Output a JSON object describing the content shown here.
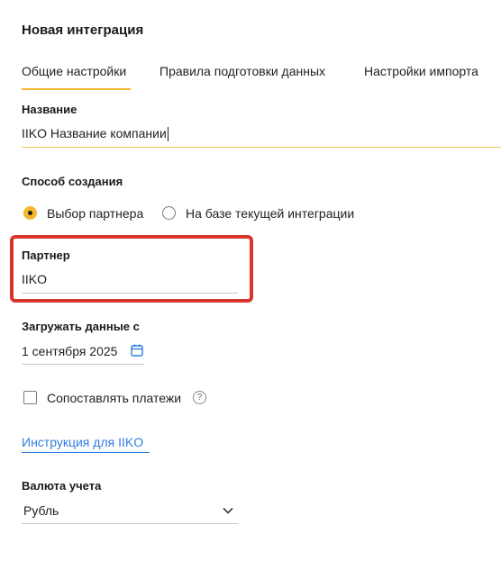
{
  "header": {
    "title": "Новая интеграция"
  },
  "tabs": [
    {
      "label": "Общие настройки",
      "active": true
    },
    {
      "label": "Правила подготовки данных",
      "active": false
    },
    {
      "label": "Настройки импорта",
      "active": false
    }
  ],
  "name_field": {
    "label": "Название",
    "value": "IIKO Название компании"
  },
  "creation_method": {
    "label": "Способ создания",
    "options": [
      {
        "label": "Выбор партнера",
        "selected": true
      },
      {
        "label": "На базе текущей интеграции",
        "selected": false
      }
    ]
  },
  "partner_field": {
    "label": "Партнер",
    "value": "IIKO"
  },
  "load_from": {
    "label": "Загружать данные с",
    "value": "1 сентября 2025"
  },
  "match_payments": {
    "label": "Сопоставлять платежи",
    "checked": false,
    "help_glyph": "?"
  },
  "instruction_link": {
    "label": "Инструкция для IIKO"
  },
  "currency": {
    "label": "Валюта учета",
    "value": "Рубль"
  },
  "colors": {
    "accent": "#f5b72e",
    "link": "#2f7de1",
    "highlight": "#d8352d"
  }
}
